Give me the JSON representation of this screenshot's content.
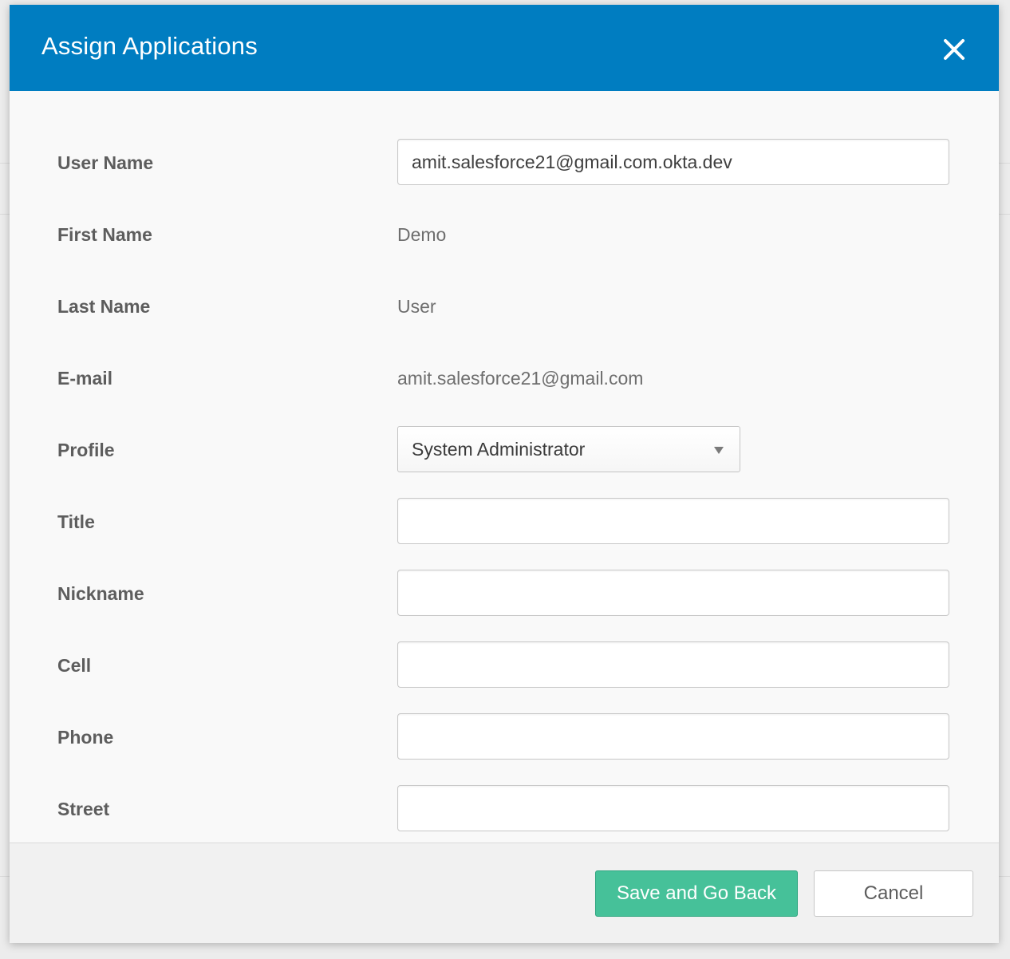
{
  "dialog": {
    "title": "Assign Applications",
    "close_icon": "close-icon"
  },
  "form": {
    "fields": [
      {
        "label": "User Name",
        "type": "input",
        "value": "amit.salesforce21@gmail.com.okta.dev"
      },
      {
        "label": "First Name",
        "type": "text",
        "value": "Demo"
      },
      {
        "label": "Last Name",
        "type": "text",
        "value": "User"
      },
      {
        "label": "E-mail",
        "type": "text",
        "value": "amit.salesforce21@gmail.com"
      },
      {
        "label": "Profile",
        "type": "select",
        "value": "System Administrator"
      },
      {
        "label": "Title",
        "type": "input",
        "value": ""
      },
      {
        "label": "Nickname",
        "type": "input",
        "value": ""
      },
      {
        "label": "Cell",
        "type": "input",
        "value": ""
      },
      {
        "label": "Phone",
        "type": "input",
        "value": ""
      },
      {
        "label": "Street",
        "type": "input",
        "value": ""
      }
    ]
  },
  "footer": {
    "save_label": "Save and Go Back",
    "cancel_label": "Cancel"
  },
  "colors": {
    "header": "#007dc1",
    "primary_button": "#46c199",
    "body_background": "#f9f9f9"
  }
}
